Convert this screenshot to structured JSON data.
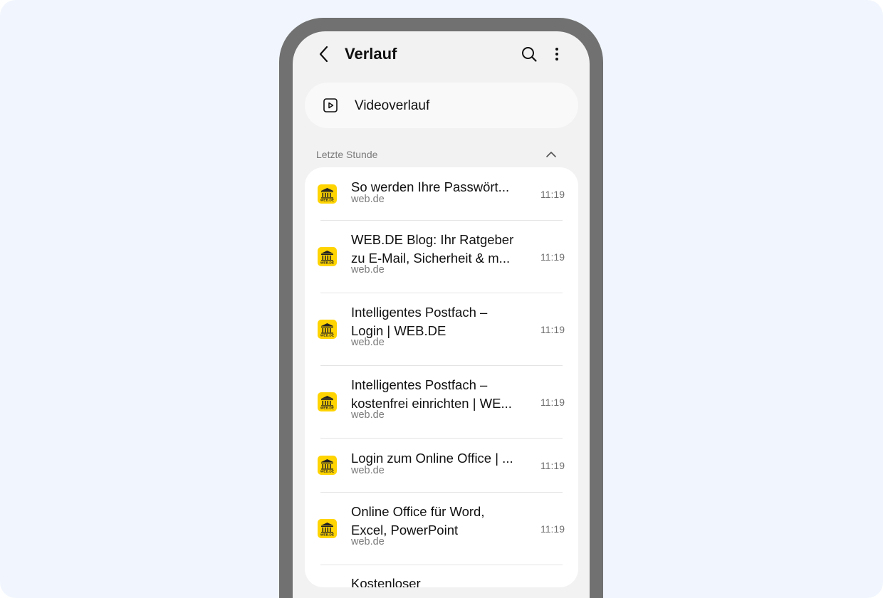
{
  "header": {
    "title": "Verlauf",
    "icons": [
      "back-icon",
      "search-icon",
      "more-vert-icon"
    ]
  },
  "video_history": {
    "label": "Videoverlauf",
    "icon": "play-square-icon"
  },
  "section": {
    "title": "Letzte Stunde",
    "icon": "chevron-up-icon"
  },
  "favicon_color": "#ffd400",
  "items": [
    {
      "title_line1": "So werden Ihre Passwört...",
      "title_line2": "",
      "domain": "web.de",
      "time": "11:19"
    },
    {
      "title_line1": "WEB.DE Blog: Ihr Ratgeber",
      "title_line2": "zu E-Mail, Sicherheit & m...",
      "domain": "web.de",
      "time": "11:19"
    },
    {
      "title_line1": "Intelligentes Postfach –",
      "title_line2": "Login | WEB.DE",
      "domain": "web.de",
      "time": "11:19"
    },
    {
      "title_line1": "Intelligentes Postfach –",
      "title_line2": "kostenfrei einrichten | WE...",
      "domain": "web.de",
      "time": "11:19"
    },
    {
      "title_line1": "Login zum Online Office | ...",
      "title_line2": "",
      "domain": "web.de",
      "time": "11:19"
    },
    {
      "title_line1": "Online Office für Word,",
      "title_line2": "Excel, PowerPoint",
      "domain": "web.de",
      "time": "11:19"
    },
    {
      "title_line1": "Kostenloser",
      "title_line2": "",
      "domain": "",
      "time": ""
    }
  ]
}
